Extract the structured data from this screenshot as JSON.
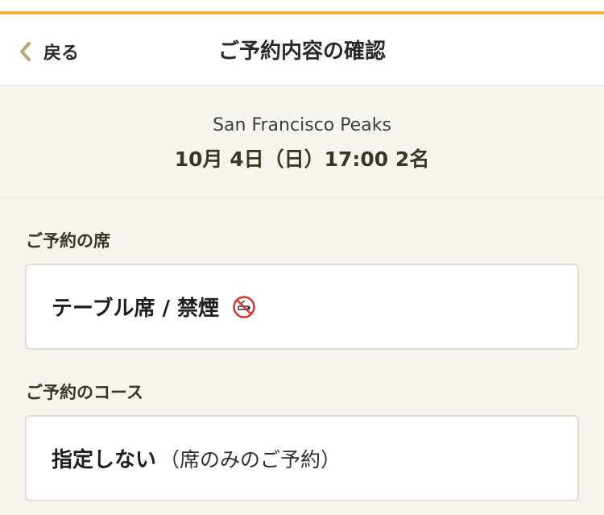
{
  "header": {
    "back_label": "戻る",
    "title": "ご予約内容の確認"
  },
  "summary": {
    "restaurant": "San Francisco Peaks",
    "datetime": "10月 4日（日）17:00 2名"
  },
  "seat": {
    "section_label": "ご予約の席",
    "value": "テーブル席 / 禁煙",
    "icon": "no-smoking-icon"
  },
  "course": {
    "section_label": "ご予約のコース",
    "value_main": "指定しない",
    "value_sub": "（席のみのご予約）"
  },
  "colors": {
    "accent": "#f0b43c",
    "back_chevron": "#b8a87a",
    "no_smoking_red": "#d8332f"
  }
}
